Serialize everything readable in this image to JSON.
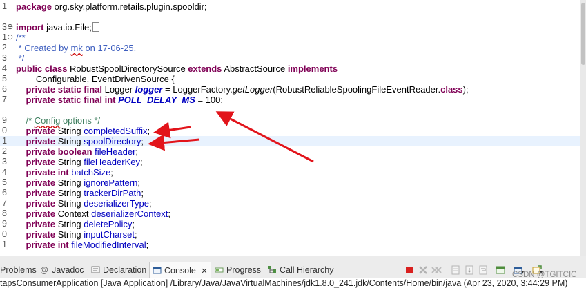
{
  "editor": {
    "lines": [
      {
        "ln": "1",
        "fold": "",
        "html": "<span class='kw'>package</span> org.sky.platform.retails.plugin.spooldir;"
      },
      {
        "ln": "",
        "fold": "",
        "html": ""
      },
      {
        "ln": "3",
        "fold": "⊕",
        "html": "<span class='kw'>import</span> java.io.File;<span class='boxed'></span>"
      },
      {
        "ln": "1",
        "fold": "⊖",
        "html": "<span class='cm'>/**</span>"
      },
      {
        "ln": "2",
        "fold": "",
        "html": "<span class='cm'> * Created by <span class='squig'>mk</span> on 17-06-25.</span>"
      },
      {
        "ln": "3",
        "fold": "",
        "html": "<span class='cm'> */</span>"
      },
      {
        "ln": "4",
        "fold": "",
        "html": "<span class='kw'>public class</span> RobustSpoolDirectorySource <span class='kw'>extends</span> AbstractSource <span class='kw'>implements</span>"
      },
      {
        "ln": "5",
        "fold": "",
        "html": "        Configurable, EventDrivenSource {"
      },
      {
        "ln": "6",
        "fold": "",
        "html": "    <span class='kw'>private static final</span> Logger <span class='sfb'>logger</span> = LoggerFactory.<span class='mi'>getLogger</span>(RobustReliableSpoolingFileEventReader.<span class='kw'>class</span>);"
      },
      {
        "ln": "7",
        "fold": "",
        "html": "    <span class='kw'>private static final int</span> <span class='sfb'>POLL_DELAY_MS</span> = 100;"
      },
      {
        "ln": "",
        "fold": "",
        "html": ""
      },
      {
        "ln": "9",
        "fold": "",
        "html": "    <span class='lcm'>/* <span class='squig'>Config</span> options */</span>"
      },
      {
        "ln": "0",
        "fold": "",
        "html": "    <span class='kw'>private</span> String <span class='fld'>completedSuffix</span>;"
      },
      {
        "ln": "1",
        "fold": "",
        "current": true,
        "html": "    <span class='kw'>private</span> String <span class='fld'>spoolDirectory</span>;"
      },
      {
        "ln": "2",
        "fold": "",
        "html": "    <span class='kw'>private boolean</span> <span class='fld'>fileHeader</span>;"
      },
      {
        "ln": "3",
        "fold": "",
        "html": "    <span class='kw'>private</span> String <span class='fld'>fileHeaderKey</span>;"
      },
      {
        "ln": "4",
        "fold": "",
        "html": "    <span class='kw'>private int</span> <span class='fld'>batchSize</span>;"
      },
      {
        "ln": "5",
        "fold": "",
        "html": "    <span class='kw'>private</span> String <span class='fld'>ignorePattern</span>;"
      },
      {
        "ln": "6",
        "fold": "",
        "html": "    <span class='kw'>private</span> String <span class='fld'>trackerDirPath</span>;"
      },
      {
        "ln": "7",
        "fold": "",
        "html": "    <span class='kw'>private</span> String <span class='fld'>deserializerType</span>;"
      },
      {
        "ln": "8",
        "fold": "",
        "html": "    <span class='kw'>private</span> Context <span class='fld'>deserializerContext</span>;"
      },
      {
        "ln": "9",
        "fold": "",
        "html": "    <span class='kw'>private</span> String <span class='fld'>deletePolicy</span>;"
      },
      {
        "ln": "0",
        "fold": "",
        "html": "    <span class='kw'>private</span> String <span class='fld'>inputCharset</span>;"
      },
      {
        "ln": "1",
        "fold": "",
        "html": "    <span class='kw'>private int</span> <span class='fld'>fileModifiedInterval</span>;"
      }
    ]
  },
  "panel": {
    "tabs": [
      {
        "label": "Problems",
        "icon": "problems-icon",
        "active": false
      },
      {
        "label": "Javadoc",
        "icon": "javadoc-icon",
        "active": false
      },
      {
        "label": "Declaration",
        "icon": "declaration-icon",
        "active": false
      },
      {
        "label": "Console",
        "icon": "console-icon",
        "active": true,
        "close": "✕"
      },
      {
        "label": "Progress",
        "icon": "progress-icon",
        "active": false
      },
      {
        "label": "Call Hierarchy",
        "icon": "call-hierarchy-icon",
        "active": false
      }
    ],
    "console_text": "tapsConsumerApplication [Java Application] /Library/Java/JavaVirtualMachines/jdk1.8.0_241.jdk/Contents/Home/bin/java (Apr 23, 2020, 3:44:29 PM)"
  },
  "watermark": "CSDN @TGITCIC",
  "colors": {
    "keyword": "#7f0055",
    "field": "#0000c0",
    "javadoc": "#3f5fbf",
    "comment": "#3f7f5f",
    "arrow": "#e2141b",
    "current_line": "#e8f2fe"
  }
}
